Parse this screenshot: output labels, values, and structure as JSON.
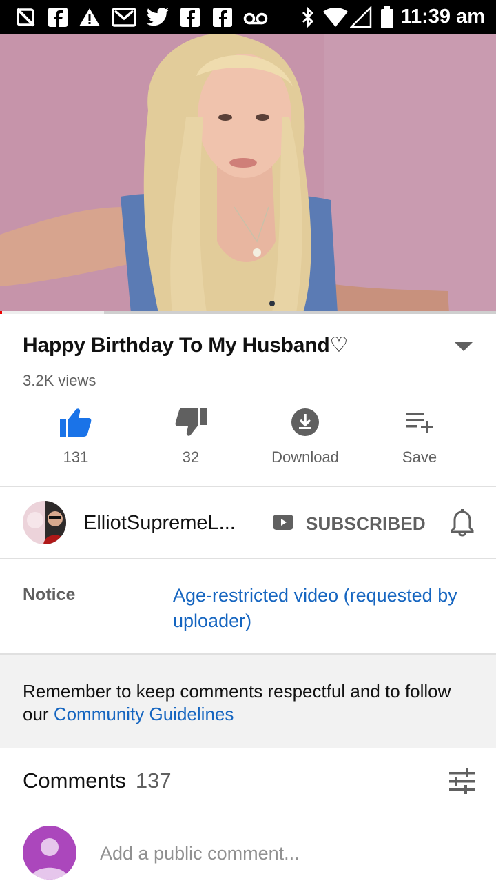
{
  "status_bar": {
    "time": "11:39 am",
    "icons": [
      "no-notification-icon",
      "facebook-icon",
      "warning-icon",
      "gmail-icon",
      "twitter-icon",
      "facebook-icon",
      "facebook-icon",
      "voicemail-icon",
      "bluetooth-icon",
      "wifi-icon",
      "signal-icon",
      "battery-icon"
    ]
  },
  "video": {
    "progress_played": 0.004,
    "progress_buffered": 0.21
  },
  "title": "Happy Birthday To My Husband♡",
  "views": "3.2K views",
  "actions": {
    "like_count": "131",
    "dislike_count": "32",
    "download_label": "Download",
    "save_label": "Save"
  },
  "channel": {
    "name": "ElliotSupremeL...",
    "subscribed_label": "SUBSCRIBED"
  },
  "notice": {
    "label": "Notice",
    "value": "Age-restricted video (requested by uploader)"
  },
  "guidelines": {
    "text": "Remember to keep comments respectful and to follow our",
    "link": "Community Guidelines"
  },
  "comments": {
    "label": "Comments",
    "count": "137",
    "placeholder": "Add a public comment..."
  },
  "colors": {
    "accent_blue": "#1565c0",
    "like_blue": "#1a73e8",
    "progress_red": "#e00000",
    "avatar_purple": "#ab47bc"
  }
}
